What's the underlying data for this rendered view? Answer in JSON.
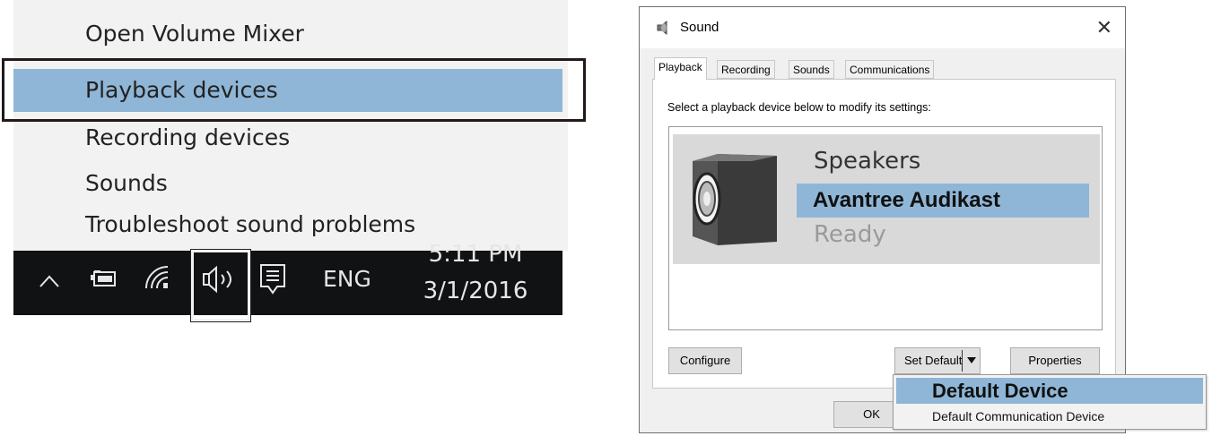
{
  "context_menu": {
    "items": [
      {
        "label": "Open Volume Mixer"
      },
      {
        "label": "Playback devices"
      },
      {
        "label": "Recording devices"
      },
      {
        "label": "Sounds"
      },
      {
        "label": "Troubleshoot sound problems"
      }
    ],
    "highlight_color": "#8fb6d6"
  },
  "taskbar": {
    "language": "ENG",
    "time": "5:11 PM",
    "date": "3/1/2016",
    "icons": [
      "chevron-up-icon",
      "battery-icon",
      "wifi-icon",
      "speaker-icon",
      "notification-icon"
    ]
  },
  "dialog": {
    "title": "Sound",
    "close_glyph": "✕",
    "tabs": [
      "Playback",
      "Recording",
      "Sounds",
      "Communications"
    ],
    "instruction": "Select a playback device below to modify its settings:",
    "device": {
      "name": "Speakers",
      "description": "Avantree Audikast",
      "status": "Ready"
    },
    "buttons": {
      "configure": "Configure",
      "set_default": "Set Default",
      "properties": "Properties",
      "ok": "OK"
    },
    "dropdown": [
      "Default Device",
      "Default Communication Device"
    ]
  }
}
